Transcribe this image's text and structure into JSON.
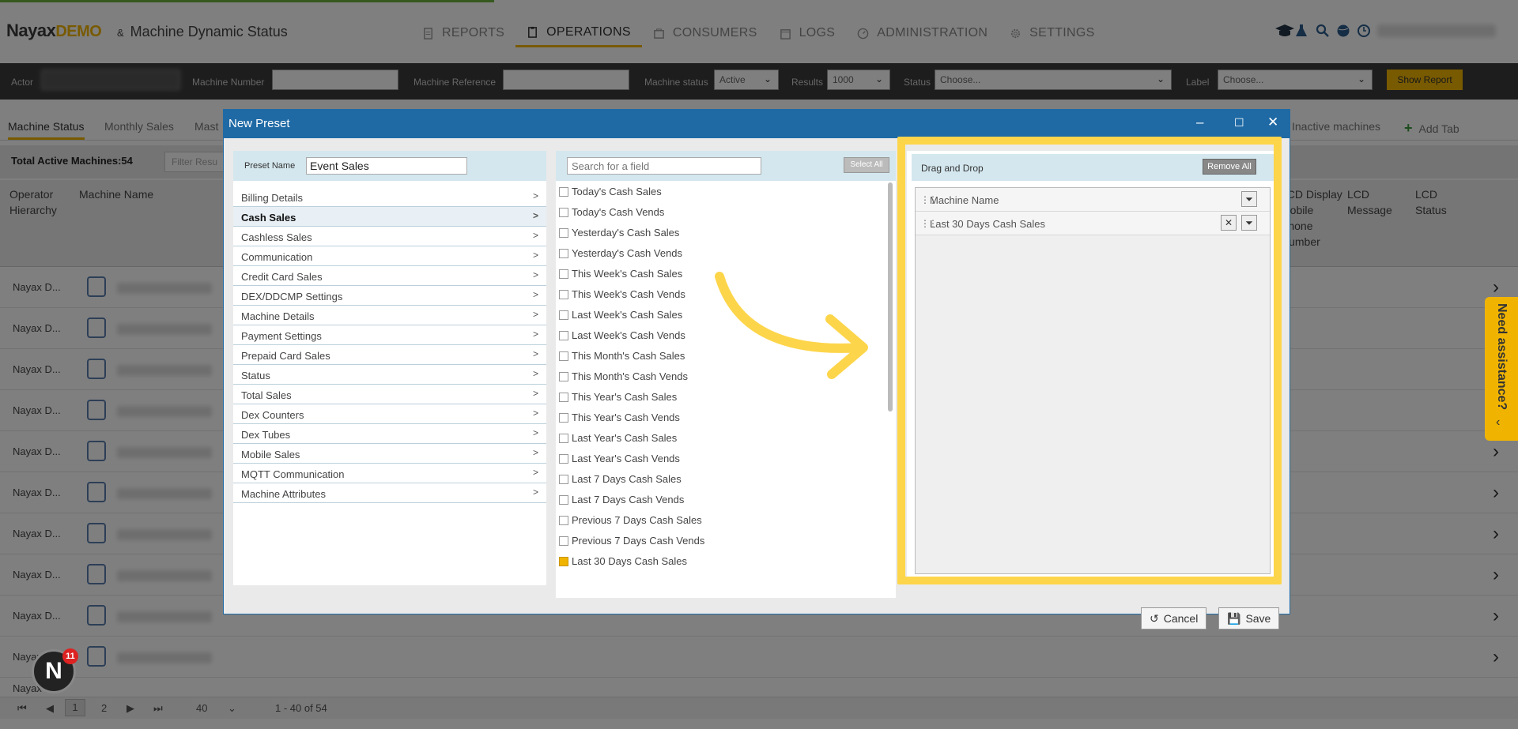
{
  "brand": {
    "name": "Nayax",
    "tag": "DEMO"
  },
  "page_title": {
    "amp": "&",
    "text": "Machine Dynamic Status"
  },
  "main_nav": [
    {
      "label": "REPORTS",
      "icon": "report-icon"
    },
    {
      "label": "OPERATIONS",
      "icon": "clipboard-icon",
      "active": true
    },
    {
      "label": "CONSUMERS",
      "icon": "consumers-icon"
    },
    {
      "label": "LOGS",
      "icon": "calendar-icon"
    },
    {
      "label": "ADMINISTRATION",
      "icon": "gauge-icon"
    },
    {
      "label": "SETTINGS",
      "icon": "gear-icon"
    }
  ],
  "filters": {
    "actor_label": "Actor",
    "machine_number_label": "Machine Number",
    "machine_reference_label": "Machine Reference",
    "machine_status_label": "Machine status",
    "machine_status_value": "Active",
    "results_label": "Results",
    "results_value": "1000",
    "status_label": "Status",
    "status_placeholder": "Choose...",
    "label_label": "Label",
    "label_placeholder": "Choose...",
    "show_report": "Show Report"
  },
  "tabs": {
    "machine_status": "Machine Status",
    "monthly_sales": "Monthly Sales",
    "partial": "Mast",
    "inactive": "Inactive machines",
    "add_tab": "Add Tab"
  },
  "grid": {
    "total": "Total Active Machines:54",
    "filter_placeholder": "Filter Resu",
    "headers": {
      "operator": "Operator Hierarchy",
      "machine_name": "Machine Name",
      "lcd_display": "LCD Display Mobile Phone Number",
      "lcd_message": "LCD Message",
      "lcd_status": "LCD Status"
    },
    "rows": [
      "Nayax D...",
      "Nayax D...",
      "Nayax D...",
      "Nayax D...",
      "Nayax D...",
      "Nayax D...",
      "Nayax D...",
      "Nayax D...",
      "Nayax D...",
      "Nayax D...",
      "Nayax D..."
    ]
  },
  "pager": {
    "page_1": "1",
    "page_2": "2",
    "page_size": "40",
    "range": "1 - 40 of 54"
  },
  "modal": {
    "title": "New Preset",
    "preset_name_label": "Preset Name",
    "preset_name_value": "Event Sales",
    "categories": [
      "Billing Details",
      "Cash Sales",
      "Cashless Sales",
      "Communication",
      "Credit Card Sales",
      "DEX/DDCMP Settings",
      "Machine Details",
      "Payment Settings",
      "Prepaid Card Sales",
      "Status",
      "Total Sales",
      "Dex Counters",
      "Dex Tubes",
      "Mobile Sales",
      "MQTT Communication",
      "Machine Attributes"
    ],
    "selected_category": "Cash Sales",
    "search_placeholder": "Search for a field",
    "select_all": "Select All",
    "fields": [
      "Today's Cash Sales",
      "Today's Cash Vends",
      "Yesterday's Cash Sales",
      "Yesterday's Cash Vends",
      "This Week's Cash Sales",
      "This Week's Cash Vends",
      "Last Week's Cash Sales",
      "Last Week's Cash Vends",
      "This Month's Cash Sales",
      "This Month's Cash Vends",
      "This Year's Cash Sales",
      "This Year's Cash Vends",
      "Last Year's Cash Sales",
      "Last Year's Cash Vends",
      "Last 7 Days Cash Sales",
      "Last 7 Days Cash Vends",
      "Previous 7 Days Cash Sales",
      "Previous 7 Days Cash Vends",
      "Last 30 Days Cash Sales"
    ],
    "checked_field": "Last 30 Days Cash Sales",
    "drag_drop_title": "Drag and Drop",
    "remove_all": "Remove All",
    "selected_fields": [
      "Machine Name",
      "Last 30 Days Cash Sales"
    ],
    "cancel": "Cancel",
    "save": "Save"
  },
  "help_tab": "Need assistance?",
  "notification_badge": {
    "letter": "N",
    "count": "11"
  },
  "colors": {
    "accent": "#f0b400",
    "modal_header": "#1f6aa5",
    "highlight": "#fdd54a"
  }
}
